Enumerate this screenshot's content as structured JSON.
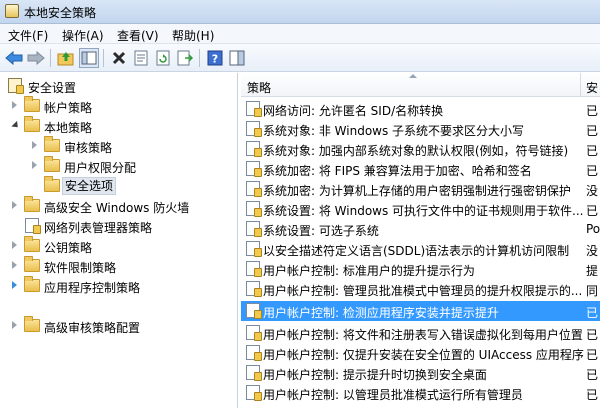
{
  "window": {
    "title": "本地安全策略"
  },
  "menu": [
    {
      "label": "文件(F)"
    },
    {
      "label": "操作(A)"
    },
    {
      "label": "查看(V)"
    },
    {
      "label": "帮助(H)"
    }
  ],
  "toolbar": {
    "icons": [
      "back-arrow-icon",
      "forward-arrow-icon",
      "up-folder-icon",
      "show-hide-tree-icon",
      "delete-icon",
      "properties-icon",
      "refresh-icon",
      "export-list-icon",
      "help-icon",
      "action-pane-icon"
    ]
  },
  "tree": {
    "root": "安全设置",
    "items": [
      {
        "label": "帐户策略",
        "icon": "folder-icon"
      },
      {
        "label": "本地策略",
        "icon": "folder-icon"
      },
      {
        "label": "审核策略",
        "icon": "folder-icon"
      },
      {
        "label": "用户权限分配",
        "icon": "folder-icon"
      },
      {
        "label": "安全选项",
        "icon": "folder-icon",
        "selected": true
      },
      {
        "label": "高级安全 Windows 防火墙",
        "icon": "folder-icon"
      },
      {
        "label": "网络列表管理器策略",
        "icon": "policy-icon"
      },
      {
        "label": "公钥策略",
        "icon": "folder-icon"
      },
      {
        "label": "软件限制策略",
        "icon": "folder-icon"
      },
      {
        "label": "应用程序控制策略",
        "icon": "folder-icon"
      },
      {
        "label": "高级审核策略配置",
        "icon": "folder-icon"
      }
    ]
  },
  "list": {
    "column_policy": "策略",
    "column_setting": "安",
    "rows": [
      {
        "policy": "网络访问: 允许匿名 SID/名称转换",
        "value": "已"
      },
      {
        "policy": "系统对象: 非 Windows 子系统不要求区分大小写",
        "value": "已"
      },
      {
        "policy": "系统对象: 加强内部系统对象的默认权限(例如，符号链接)",
        "value": "已"
      },
      {
        "policy": "系统加密: 将 FIPS 兼容算法用于加密、哈希和签名",
        "value": "已"
      },
      {
        "policy": "系统加密: 为计算机上存储的用户密钥强制进行强密钥保护",
        "value": "没"
      },
      {
        "policy": "系统设置: 将 Windows 可执行文件中的证书规则用于软件...",
        "value": "已"
      },
      {
        "policy": "系统设置: 可选子系统",
        "value": "Po"
      },
      {
        "policy": "以安全描述符定义语言(SDDL)语法表示的计算机访问限制",
        "value": "没"
      },
      {
        "policy": "用户帐户控制: 标准用户的提升提示行为",
        "value": "提"
      },
      {
        "policy": "用户帐户控制: 管理员批准模式中管理员的提升权限提示的...",
        "value": "同"
      },
      {
        "policy": "用户帐户控制: 检测应用程序安装并提示提升",
        "value": "已",
        "selected": true
      },
      {
        "policy": "用户帐户控制: 将文件和注册表写入错误虚拟化到每用户位置",
        "value": "已"
      },
      {
        "policy": "用户帐户控制: 仅提升安装在安全位置的 UIAccess 应用程序",
        "value": "已"
      },
      {
        "policy": "用户帐户控制: 提示提升时切换到安全桌面",
        "value": "已"
      },
      {
        "policy": "用户帐户控制: 以管理员批准模式运行所有管理员",
        "value": "已"
      }
    ]
  }
}
